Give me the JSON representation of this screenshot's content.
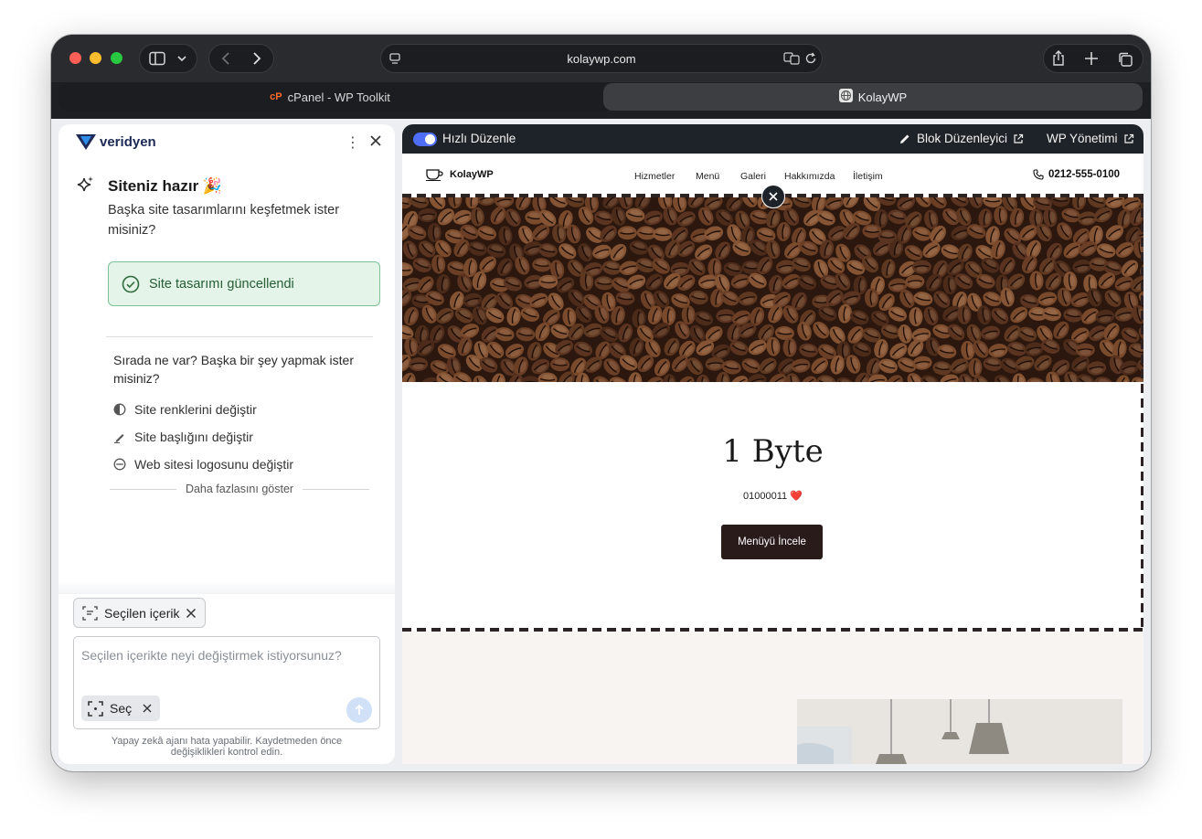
{
  "browser": {
    "url": "kolaywp.com",
    "tabs": [
      {
        "label": "cPanel - WP Toolkit",
        "active": false
      },
      {
        "label": "KolayWP",
        "active": true
      }
    ]
  },
  "assistant": {
    "brand": "veridyen",
    "title": "Siteniz hazır 🎉",
    "subtitle": "Başka site tasarımlarını keşfetmek ister misiniz?",
    "success_message": "Site tasarımı güncellendi",
    "next_question": "Sırada ne var? Başka bir şey yapmak ister misiniz?",
    "options": [
      {
        "label": "Site renklerini değiştir",
        "icon": "contrast-icon"
      },
      {
        "label": "Site başlığını değiştir",
        "icon": "pencil-icon"
      },
      {
        "label": "Web sitesi logosunu değiştir",
        "icon": "logo-icon"
      }
    ],
    "show_more": "Daha fazlasını göster",
    "selected_chip": "Seçilen içerik",
    "input_placeholder": "Seçilen içerikte neyi değiştirmek istiyorsunuz?",
    "select_button": "Seç",
    "disclaimer": "Yapay zekâ ajanı hata yapabilir. Kaydetmeden önce değişiklikleri kontrol edin."
  },
  "editbar": {
    "quick_edit": "Hızlı Düzenle",
    "quick_edit_on": true,
    "block_editor": "Blok Düzenleyici",
    "wp_admin": "WP Yönetimi"
  },
  "site": {
    "logo_text": "KolayWP",
    "nav": [
      "Hizmetler",
      "Menü",
      "Galeri",
      "Hakkımızda",
      "İletişim"
    ],
    "phone": "0212-555-0100",
    "heading": "1 Byte",
    "binary_line": "01000011 ❤️",
    "cta": "Menüyü İncele"
  },
  "colors": {
    "accent": "#4f6ef7",
    "success_bg": "#e4f4e8",
    "success_border": "#7cc394",
    "cta_bg": "#2a1b1b",
    "brand": "#1d2a57"
  }
}
